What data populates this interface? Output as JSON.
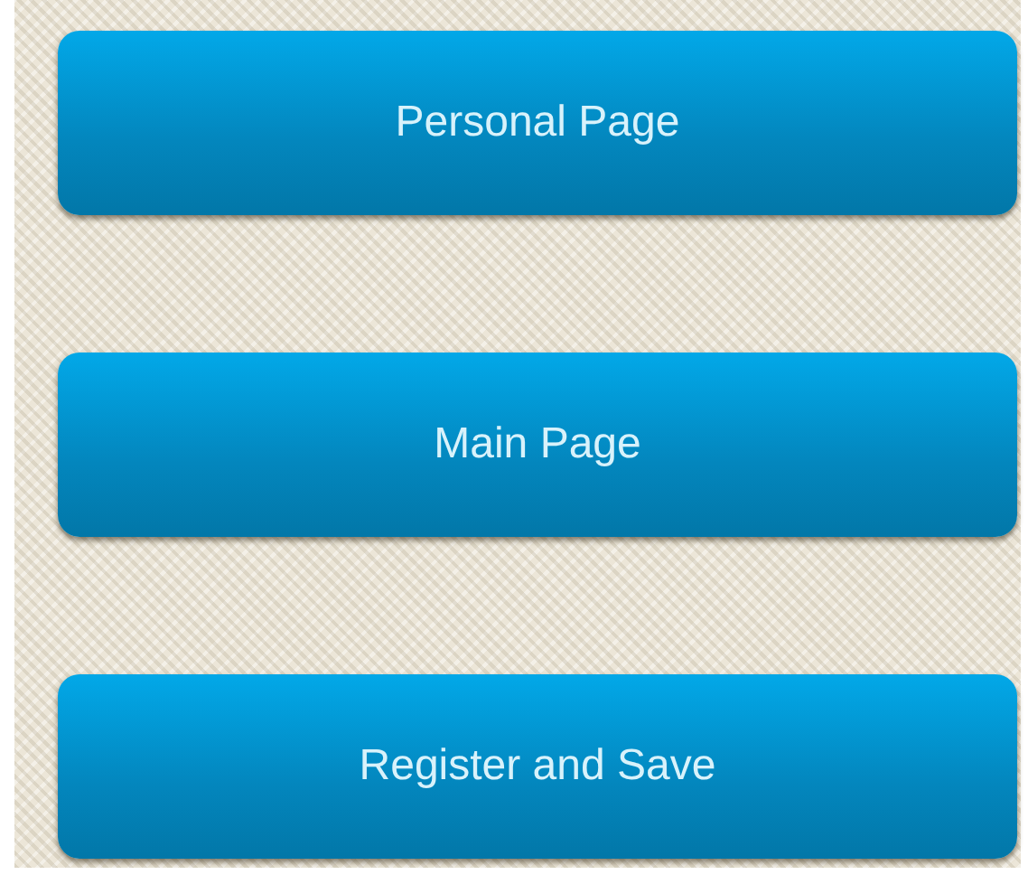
{
  "buttons": [
    {
      "label": "Personal Page"
    },
    {
      "label": "Main Page"
    },
    {
      "label": "Register and Save"
    }
  ]
}
